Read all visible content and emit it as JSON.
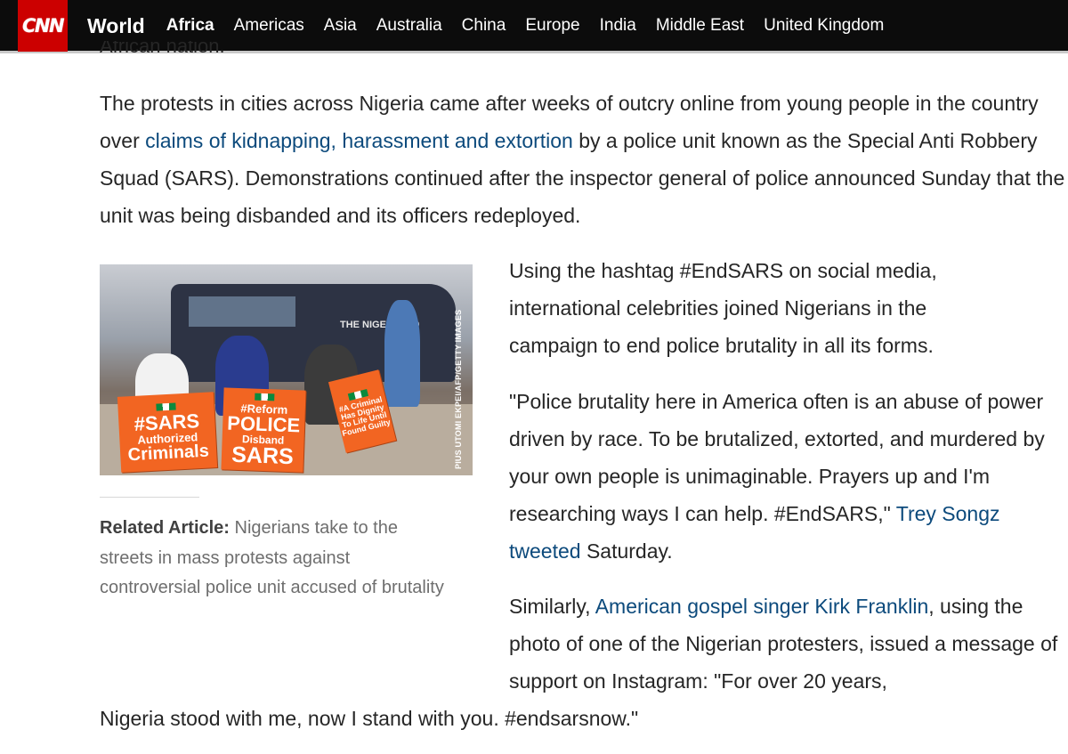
{
  "header": {
    "logo_text": "CNN",
    "section": "World",
    "nav_items": [
      {
        "label": "Africa",
        "active": true
      },
      {
        "label": "Americas",
        "active": false
      },
      {
        "label": "Asia",
        "active": false
      },
      {
        "label": "Australia",
        "active": false
      },
      {
        "label": "China",
        "active": false
      },
      {
        "label": "Europe",
        "active": false
      },
      {
        "label": "India",
        "active": false
      },
      {
        "label": "Middle East",
        "active": false
      },
      {
        "label": "United Kingdom",
        "active": false
      }
    ],
    "bg_color": "#0c0c0c",
    "logo_color": "#cc0000"
  },
  "article": {
    "cutoff_text": "African nation.",
    "p1": {
      "before": "The protests in cities across Nigeria came after weeks of outcry online from young people in the country over ",
      "link": "claims of kidnapping, harassment and extortion",
      "after": " by a police unit known as the Special Anti Robbery Squad (SARS). Demonstrations continued after the inspector general of police announced Sunday that the unit was being disbanded and its officers redeployed."
    },
    "p2": "Using the hashtag #EndSARS on social media, international celebrities joined Nigerians in the campaign to end police brutality in all its forms.",
    "p3": {
      "before": "\"Police brutality here in America often is an abuse of power driven by race. To be brutalized, extorted, and murdered by your own people is unimaginable. Prayers up and I'm researching ways I can help. #EndSARS,\" ",
      "link": "Trey Songz tweeted",
      "after": " Saturday."
    },
    "p4": {
      "before": "Similarly, ",
      "link": "American gospel singer Kirk Franklin",
      "after": ", using the photo of one of the Nigerian protesters, issued a message of support on Instagram: \"For over 20 years,"
    },
    "p5": "Nigeria stood with me, now I stand with you. #endsarsnow.\"",
    "link_color": "#0c4a7c"
  },
  "figure": {
    "credit": "PIUS UTOMI EKPEI/AFP/GETTY IMAGES",
    "van_text": "THE NIGERIA PO",
    "sign_1": [
      "#SARS",
      "Authorized",
      "Criminals"
    ],
    "sign_2": [
      "#Reform",
      "POLICE",
      "Disband",
      "SARS"
    ],
    "sign_3": [
      "#A Criminal",
      "Has Dignity",
      "To Life Until",
      "Found Guilty"
    ]
  },
  "related": {
    "label": "Related Article:",
    "text": " Nigerians take to the streets in mass protests against controversial police unit accused of brutality"
  }
}
